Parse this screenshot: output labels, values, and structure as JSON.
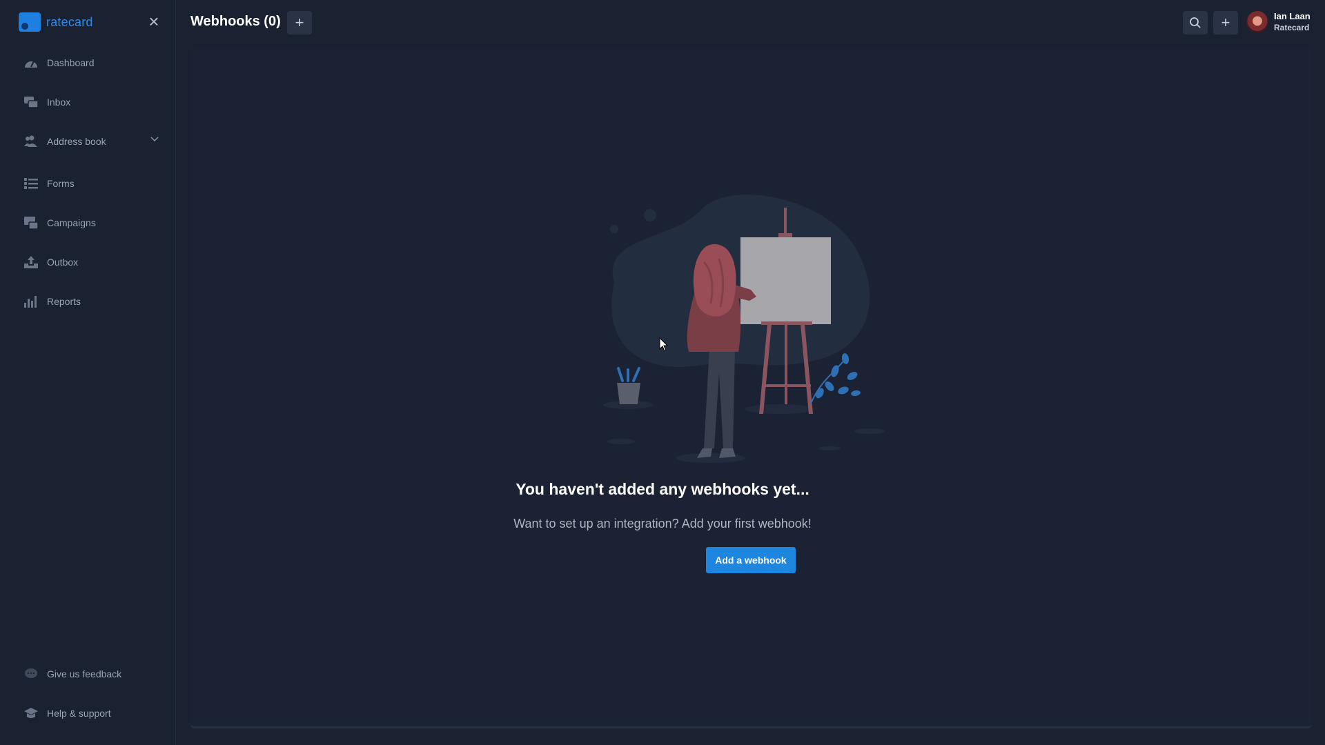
{
  "app": {
    "brand": "ratecard",
    "accent_color": "#1f86e0"
  },
  "sidebar": {
    "items": [
      {
        "label": "Dashboard",
        "icon": "dashboard-gauge-icon"
      },
      {
        "label": "Inbox",
        "icon": "inbox-chat-icon"
      },
      {
        "label": "Address book",
        "icon": "contacts-icon",
        "expandable": true
      },
      {
        "label": "Forms",
        "icon": "forms-list-icon"
      },
      {
        "label": "Campaigns",
        "icon": "campaigns-icon"
      },
      {
        "label": "Outbox",
        "icon": "outbox-upload-icon"
      },
      {
        "label": "Reports",
        "icon": "bar-chart-icon"
      }
    ],
    "footer": [
      {
        "label": "Give us feedback",
        "icon": "feedback-chat-icon"
      },
      {
        "label": "Help & support",
        "icon": "graduation-cap-icon"
      }
    ]
  },
  "header": {
    "title": "Webhooks (0)",
    "add_icon": "plus-icon",
    "search_icon": "search-icon",
    "create_icon": "plus-icon"
  },
  "user": {
    "name": "Ian Laan",
    "org": "Ratecard"
  },
  "empty_state": {
    "title": "You haven't added any webhooks yet...",
    "subtitle": "Want to set up an integration? Add your first webhook!",
    "button": "Add a webhook"
  }
}
